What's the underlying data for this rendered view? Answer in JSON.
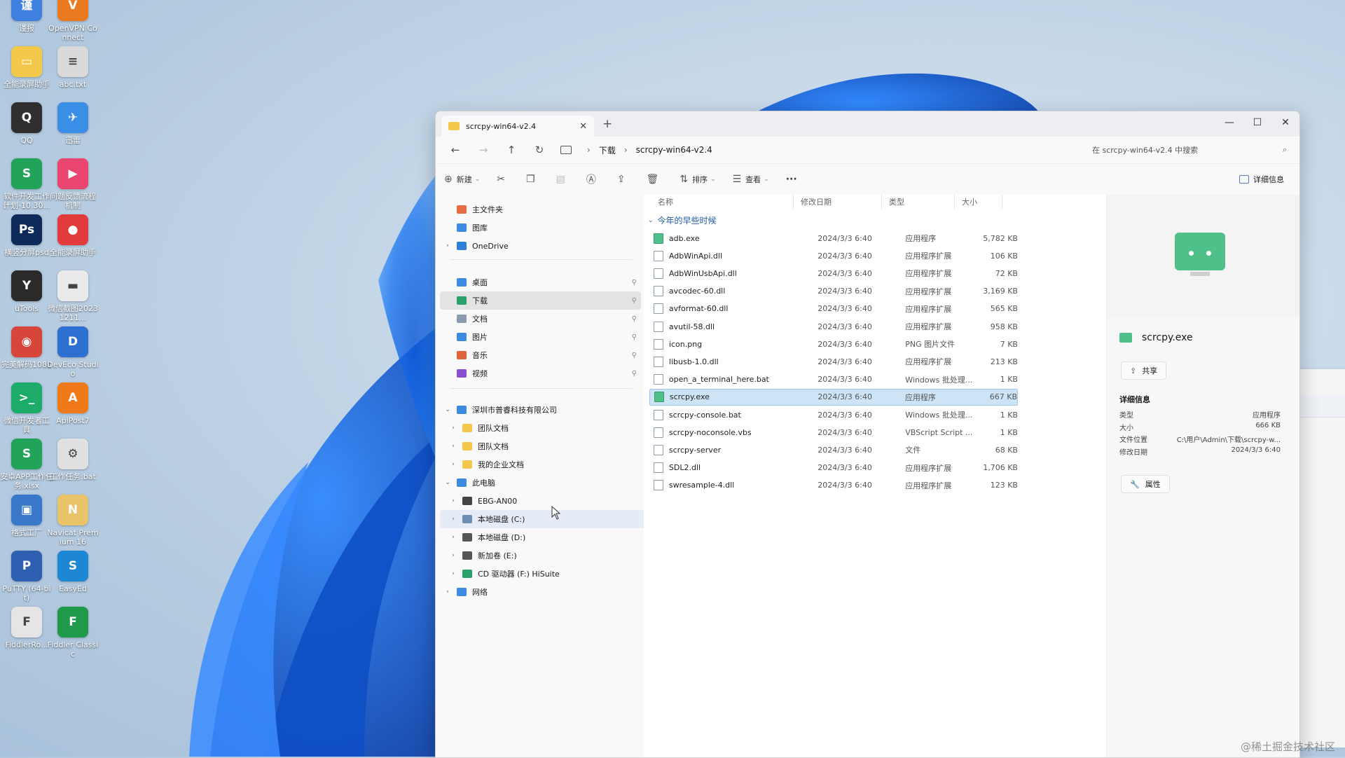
{
  "desktop": {
    "icons": [
      {
        "label": "谨报",
        "color": "#3f7fe0",
        "glyph": "谨"
      },
      {
        "label": "OpenVPN Connect",
        "color": "#ea7a22",
        "glyph": "V"
      },
      {
        "label": "全能录屏助手",
        "color": "#f4c94b",
        "glyph": "▭"
      },
      {
        "label": "abc.txt",
        "color": "#d9d9d9",
        "glyph": "≡"
      },
      {
        "label": "QQ",
        "color": "#2f2f2f",
        "glyph": "Q"
      },
      {
        "label": "迅雷",
        "color": "#3a8ee6",
        "glyph": "✈"
      },
      {
        "label": "软件开发工作计划-10.30...",
        "color": "#22a35a",
        "glyph": "S"
      },
      {
        "label": "问题反馈流程机制",
        "color": "#e94571",
        "glyph": "▶"
      },
      {
        "label": "横竖分屏psd",
        "color": "#0e2a5a",
        "glyph": "Ps"
      },
      {
        "label": "全能录屏助手",
        "color": "#e23b3b",
        "glyph": "●"
      },
      {
        "label": "uTools",
        "color": "#2b2b2b",
        "glyph": "Y"
      },
      {
        "label": "微信截图20231211...",
        "color": "#eaeaea",
        "glyph": "▬"
      },
      {
        "label": "完美解码1080",
        "color": "#d8453a",
        "glyph": "◉"
      },
      {
        "label": "DevEco Studio",
        "color": "#2d6fd1",
        "glyph": "D"
      },
      {
        "label": "微信开发者工具",
        "color": "#1dab6a",
        "glyph": ">_"
      },
      {
        "label": "ApiPost7",
        "color": "#f07a1a",
        "glyph": "A"
      },
      {
        "label": "安卓APP工作任务.xlsx",
        "color": "#22a35a",
        "glyph": "S"
      },
      {
        "label": "工作任务.bat",
        "color": "#e0e0e0",
        "glyph": "⚙"
      },
      {
        "label": "格式工厂",
        "color": "#3a78c9",
        "glyph": "▣"
      },
      {
        "label": "Navicat Premium 16",
        "color": "#e8c36a",
        "glyph": "N"
      },
      {
        "label": "PuTTY (64-bit)",
        "color": "#2f5fb0",
        "glyph": "P"
      },
      {
        "label": "EasyEd",
        "color": "#1e87d4",
        "glyph": "S"
      },
      {
        "label": "FiddlerRo...",
        "color": "#e5e5e5",
        "glyph": "F"
      },
      {
        "label": "Fiddler Classic",
        "color": "#1f9a4a",
        "glyph": "F"
      }
    ]
  },
  "window": {
    "tab_title": "scrcpy-win64-v2.4",
    "tab_close": "✕",
    "new_tab": "+",
    "controls": {
      "minimize": "—",
      "maximize": "☐",
      "close": "✕"
    },
    "nav": {
      "back": "←",
      "forward": "→",
      "up": "↑",
      "refresh": "↻"
    },
    "breadcrumb": [
      "下载",
      "scrcpy-win64-v2.4"
    ],
    "search_placeholder": "在 scrcpy-win64-v2.4 中搜索",
    "toolbar": {
      "new": "新建",
      "sort": "排序",
      "view": "查看",
      "more": "···",
      "details": "详细信息"
    }
  },
  "sidebar": {
    "items": [
      {
        "label": "主文件夹",
        "color": "#e66c43",
        "chev": ""
      },
      {
        "label": "图库",
        "color": "#3b8be0",
        "chev": ""
      },
      {
        "label": "OneDrive",
        "color": "#2c7fd6",
        "chev": "›"
      },
      {
        "label": "桌面",
        "color": "#3b8be0",
        "chev": "",
        "pin": "⚲"
      },
      {
        "label": "下载",
        "color": "#2aa06a",
        "chev": "",
        "pin": "⚲"
      },
      {
        "label": "文档",
        "color": "#8a9bb0",
        "chev": "",
        "pin": "⚲"
      },
      {
        "label": "图片",
        "color": "#3b8be0",
        "chev": "",
        "pin": "⚲"
      },
      {
        "label": "音乐",
        "color": "#e0643b",
        "chev": "",
        "pin": "⚲"
      },
      {
        "label": "视频",
        "color": "#8a4fd0",
        "chev": "",
        "pin": "⚲"
      },
      {
        "label": "深圳市普睿科技有限公司",
        "color": "#3b8be0",
        "chev": "⌄"
      },
      {
        "label": "团队文档",
        "color": "#f4c94b",
        "chev": "›"
      },
      {
        "label": "团队文档",
        "color": "#f4c94b",
        "chev": "›"
      },
      {
        "label": "我的企业文档",
        "color": "#f4c94b",
        "chev": "›"
      },
      {
        "label": "此电脑",
        "color": "#3b8be0",
        "chev": "⌄"
      },
      {
        "label": "EBG-AN00",
        "color": "#444444",
        "chev": "›"
      },
      {
        "label": "本地磁盘 (C:)",
        "color": "#6b8fb5",
        "chev": "›"
      },
      {
        "label": "本地磁盘 (D:)",
        "color": "#555555",
        "chev": "›"
      },
      {
        "label": "新加卷 (E:)",
        "color": "#555555",
        "chev": "›"
      },
      {
        "label": "CD 驱动器 (F:) HiSuite",
        "color": "#2aa06a",
        "chev": "›"
      },
      {
        "label": "网络",
        "color": "#3b8be0",
        "chev": "›"
      }
    ]
  },
  "files": {
    "columns": {
      "name": "名称",
      "date": "修改日期",
      "type": "类型",
      "size": "大小"
    },
    "group": "今年的早些时候",
    "rows": [
      {
        "name": "adb.exe",
        "date": "2024/3/3 6:40",
        "type": "应用程序",
        "size": "5,782 KB"
      },
      {
        "name": "AdbWinApi.dll",
        "date": "2024/3/3 6:40",
        "type": "应用程序扩展",
        "size": "106 KB"
      },
      {
        "name": "AdbWinUsbApi.dll",
        "date": "2024/3/3 6:40",
        "type": "应用程序扩展",
        "size": "72 KB"
      },
      {
        "name": "avcodec-60.dll",
        "date": "2024/3/3 6:40",
        "type": "应用程序扩展",
        "size": "3,169 KB"
      },
      {
        "name": "avformat-60.dll",
        "date": "2024/3/3 6:40",
        "type": "应用程序扩展",
        "size": "565 KB"
      },
      {
        "name": "avutil-58.dll",
        "date": "2024/3/3 6:40",
        "type": "应用程序扩展",
        "size": "958 KB"
      },
      {
        "name": "icon.png",
        "date": "2024/3/3 6:40",
        "type": "PNG 图片文件",
        "size": "7 KB"
      },
      {
        "name": "libusb-1.0.dll",
        "date": "2024/3/3 6:40",
        "type": "应用程序扩展",
        "size": "213 KB"
      },
      {
        "name": "open_a_terminal_here.bat",
        "date": "2024/3/3 6:40",
        "type": "Windows 批处理...",
        "size": "1 KB"
      },
      {
        "name": "scrcpy.exe",
        "date": "2024/3/3 6:40",
        "type": "应用程序",
        "size": "667 KB"
      },
      {
        "name": "scrcpy-console.bat",
        "date": "2024/3/3 6:40",
        "type": "Windows 批处理...",
        "size": "1 KB"
      },
      {
        "name": "scrcpy-noconsole.vbs",
        "date": "2024/3/3 6:40",
        "type": "VBScript Script ...",
        "size": "1 KB"
      },
      {
        "name": "scrcpy-server",
        "date": "2024/3/3 6:40",
        "type": "文件",
        "size": "68 KB"
      },
      {
        "name": "SDL2.dll",
        "date": "2024/3/3 6:40",
        "type": "应用程序扩展",
        "size": "1,706 KB"
      },
      {
        "name": "swresample-4.dll",
        "date": "2024/3/3 6:40",
        "type": "应用程序扩展",
        "size": "123 KB"
      }
    ]
  },
  "details_pane": {
    "file_name": "scrcpy.exe",
    "share": "共享",
    "section": "详细信息",
    "props": [
      {
        "k": "类型",
        "v": "应用程序"
      },
      {
        "k": "大小",
        "v": "666 KB"
      },
      {
        "k": "文件位置",
        "v": "C:\\用户\\Admin\\下载\\scrcpy-w..."
      },
      {
        "k": "修改日期",
        "v": "2024/3/3 6:40"
      }
    ],
    "properties": "属性"
  },
  "watermark": "@稀土掘金技术社区"
}
